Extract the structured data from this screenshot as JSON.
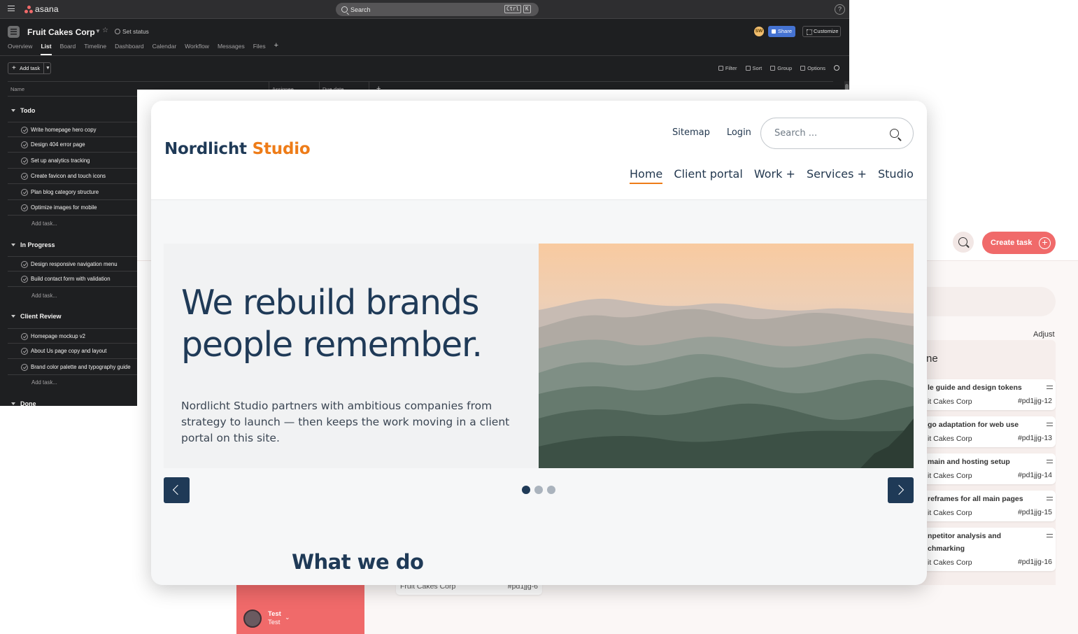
{
  "asana": {
    "brand": "asana",
    "search": {
      "placeholder": "Search",
      "kbd1": "Ctrl",
      "kbd2": "K"
    },
    "help": "?",
    "project": {
      "name": "Fruit Cakes Corp",
      "set_status": "Set status",
      "avatar_initials": "SW",
      "share_label": "Share",
      "customize_label": "Customize"
    },
    "tabs": [
      "Overview",
      "List",
      "Board",
      "Timeline",
      "Dashboard",
      "Calendar",
      "Workflow",
      "Messages",
      "Files"
    ],
    "active_tab": "List",
    "toolbar": {
      "add_task": "Add task",
      "filter": "Filter",
      "sort": "Sort",
      "group": "Group",
      "options": "Options"
    },
    "columns": [
      "Name",
      "Assignee",
      "Due date"
    ],
    "add_task_row": "Add task...",
    "sections": [
      {
        "name": "Todo",
        "tasks": [
          "Write homepage hero copy",
          "Design 404 error page",
          "Set up analytics tracking",
          "Create favicon and touch icons",
          "Plan blog category structure",
          "Optimize images for mobile"
        ]
      },
      {
        "name": "In Progress",
        "tasks": [
          "Design responsive navigation menu",
          "Build contact form with validation"
        ]
      },
      {
        "name": "Client Review",
        "tasks": [
          "Homepage mockup v2",
          "About Us page copy and layout",
          "Brand color palette and typography guide"
        ]
      },
      {
        "name": "Done",
        "tasks": []
      }
    ],
    "colors": {
      "bg": "#1e1f21",
      "topbar": "#2e2e30",
      "share": "#4573d2",
      "logo": "#f06a6a"
    }
  },
  "board": {
    "create_task": "Create task",
    "adjust": "Adjust",
    "column_name_fragment": "ne",
    "cards": [
      {
        "title": "le guide and design tokens",
        "client": "it Cakes Corp",
        "id": "#pd1jjg-12"
      },
      {
        "title": "go adaptation for web use",
        "client": "it Cakes Corp",
        "id": "#pd1jjg-13"
      },
      {
        "title": "main and hosting setup",
        "client": "it Cakes Corp",
        "id": "#pd1jjg-14"
      },
      {
        "title": "reframes for all main pages",
        "client": "it Cakes Corp",
        "id": "#pd1jjg-15"
      },
      {
        "title": "npetitor analysis and",
        "title2": "chmarking",
        "client": "it Cakes Corp",
        "id": "#pd1jjg-16"
      }
    ],
    "bottom_card": {
      "client": "Fruit Cakes Corp",
      "id": "#pd1jjg-6"
    },
    "user": {
      "name": "Test",
      "sub": "Test"
    },
    "colors": {
      "accent": "#f06a6a",
      "surface": "#fbf7f6"
    }
  },
  "site": {
    "logo_main": "Nordlicht",
    "logo_accent": "Studio",
    "utility": [
      "Sitemap",
      "Login"
    ],
    "search_placeholder": "Search ...",
    "nav": [
      "Home",
      "Client portal",
      "Work +",
      "Services +",
      "Studio"
    ],
    "active_nav": "Home",
    "hero": {
      "title": "We rebuild brands people remember.",
      "text": "Nordlicht Studio partners with ambitious companies from strategy to launch — then keeps the work moving in a client portal on this site."
    },
    "carousel": {
      "slides": 3,
      "active": 1
    },
    "section_heading": "What we do",
    "colors": {
      "primary": "#1f3a57",
      "accent": "#ee7c18"
    }
  }
}
